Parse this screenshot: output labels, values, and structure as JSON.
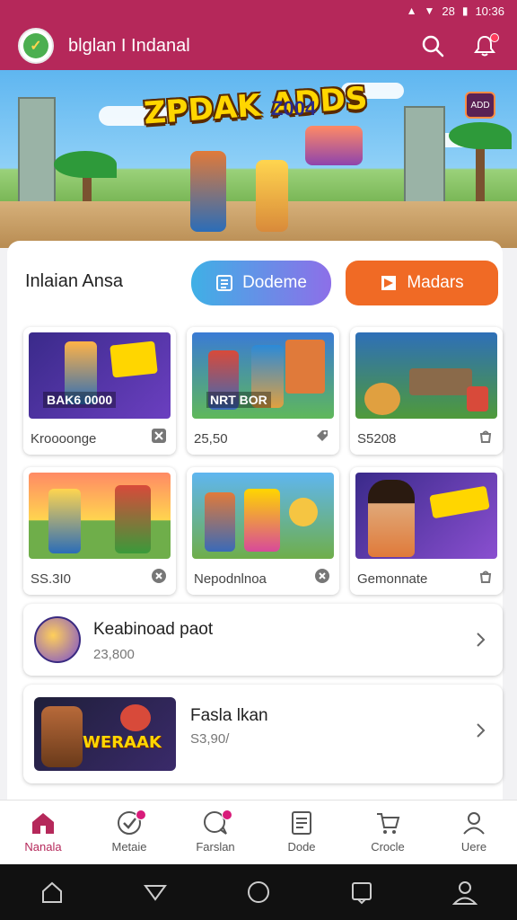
{
  "status_bar": {
    "time": "10:36",
    "battery_label": "28"
  },
  "app": {
    "title": "blglan I Indanal",
    "logo_icon": "app-logo-icon"
  },
  "banner": {
    "title": "ZPDAK ADDS",
    "year": "Z004",
    "badge": "ADD"
  },
  "section": {
    "title": "Inlaian Ansa",
    "button_primary": "Dodeme",
    "button_secondary": "Madars"
  },
  "tiles": [
    {
      "label": "Kroooonge",
      "image_text": "BAK6 0000",
      "icon": "close-icon"
    },
    {
      "label": "25,50",
      "image_text": "NRT BOR",
      "icon": "tag-icon"
    },
    {
      "label": "S5208",
      "image_text": "",
      "icon": "bag-icon"
    },
    {
      "label": "SS.3I0",
      "image_text": "",
      "icon": "close-icon"
    },
    {
      "label": "Nepodnlnoa",
      "image_text": "",
      "icon": "close-icon"
    },
    {
      "label": "Gemonnate",
      "image_text": "",
      "icon": "bag-icon"
    }
  ],
  "list": [
    {
      "title": "Keabinoad paot",
      "subtitle": "23,800"
    },
    {
      "title": "Fasla lkan",
      "subtitle": "S3,90/",
      "image_text": "WERAAK"
    }
  ],
  "bottom_nav": [
    {
      "label": "Nanala",
      "icon": "home-icon",
      "active": true
    },
    {
      "label": "Metaie",
      "icon": "check-icon",
      "badge": true
    },
    {
      "label": "Farslan",
      "icon": "chat-icon",
      "badge": true
    },
    {
      "label": "Dode",
      "icon": "document-icon"
    },
    {
      "label": "Crocle",
      "icon": "cart-icon"
    },
    {
      "label": "Uere",
      "icon": "user-icon"
    }
  ],
  "colors": {
    "primary": "#b5285a",
    "accent_orange": "#f06a25",
    "accent_blue": "#3fb0e6"
  }
}
